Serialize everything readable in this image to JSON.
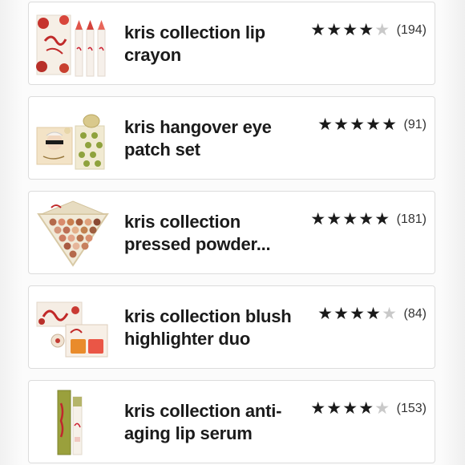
{
  "products": [
    {
      "name": "kris collection lip crayon",
      "stars": 4,
      "reviews": "(194)"
    },
    {
      "name": "kris hangover eye patch set",
      "stars": 5,
      "reviews": "(91)"
    },
    {
      "name": "kris collection pressed powder...",
      "stars": 5,
      "reviews": "(181)"
    },
    {
      "name": "kris collection blush highlighter duo",
      "stars": 4,
      "reviews": "(84)"
    },
    {
      "name": "kris collection anti-aging lip serum",
      "stars": 4,
      "reviews": "(153)"
    }
  ],
  "icons": {
    "filled_star": "star-icon",
    "empty_star": "star-outline-icon"
  },
  "colors": {
    "star_filled": "#1a1a1a",
    "star_empty": "#c9c9c9",
    "card_border": "#dcdcdc"
  }
}
